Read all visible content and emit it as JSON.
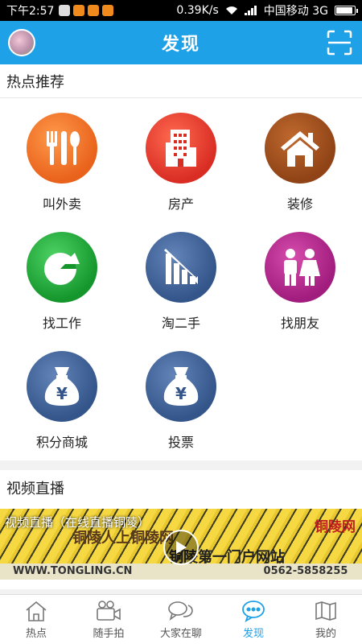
{
  "status_bar": {
    "time": "下午2:57",
    "speed": "0.39K/s",
    "carrier": "中国移动 3G",
    "battery_fraction": 0.9
  },
  "header": {
    "title": "发现"
  },
  "hot": {
    "title": "热点推荐",
    "items": [
      {
        "label": "叫外卖",
        "icon": "cutlery-icon",
        "color": "#ee6b21"
      },
      {
        "label": "房产",
        "icon": "building-icon",
        "color": "#e0352b"
      },
      {
        "label": "装修",
        "icon": "house-icon",
        "color": "#9a4b1c"
      },
      {
        "label": "找工作",
        "icon": "pie-chart-icon",
        "color": "#1fa83a"
      },
      {
        "label": "淘二手",
        "icon": "declining-chart-icon",
        "color": "#3d5f93"
      },
      {
        "label": "找朋友",
        "icon": "people-icon",
        "color": "#b0238a"
      },
      {
        "label": "积分商城",
        "icon": "money-bag-icon",
        "color": "#3d5f93"
      },
      {
        "label": "投票",
        "icon": "money-bag-icon",
        "color": "#3d5f93"
      }
    ]
  },
  "live": {
    "title": "视频直播",
    "video_caption": "视频直播（在线直播铜陵）",
    "banner_text_1": "铜陵人上铜陵网",
    "banner_text_2": "铜陵第一门户网站",
    "brand": "铜陵网",
    "url": "WWW.TONGLING.CN",
    "phone": "0562-5858255"
  },
  "tabs": [
    {
      "label": "热点",
      "icon": "house-outline-icon",
      "active": false
    },
    {
      "label": "随手拍",
      "icon": "video-camera-icon",
      "active": false
    },
    {
      "label": "大家在聊",
      "icon": "chat-bubbles-icon",
      "active": false
    },
    {
      "label": "发现",
      "icon": "discover-bubble-icon",
      "active": true
    },
    {
      "label": "我的",
      "icon": "map-icon",
      "active": false
    }
  ]
}
